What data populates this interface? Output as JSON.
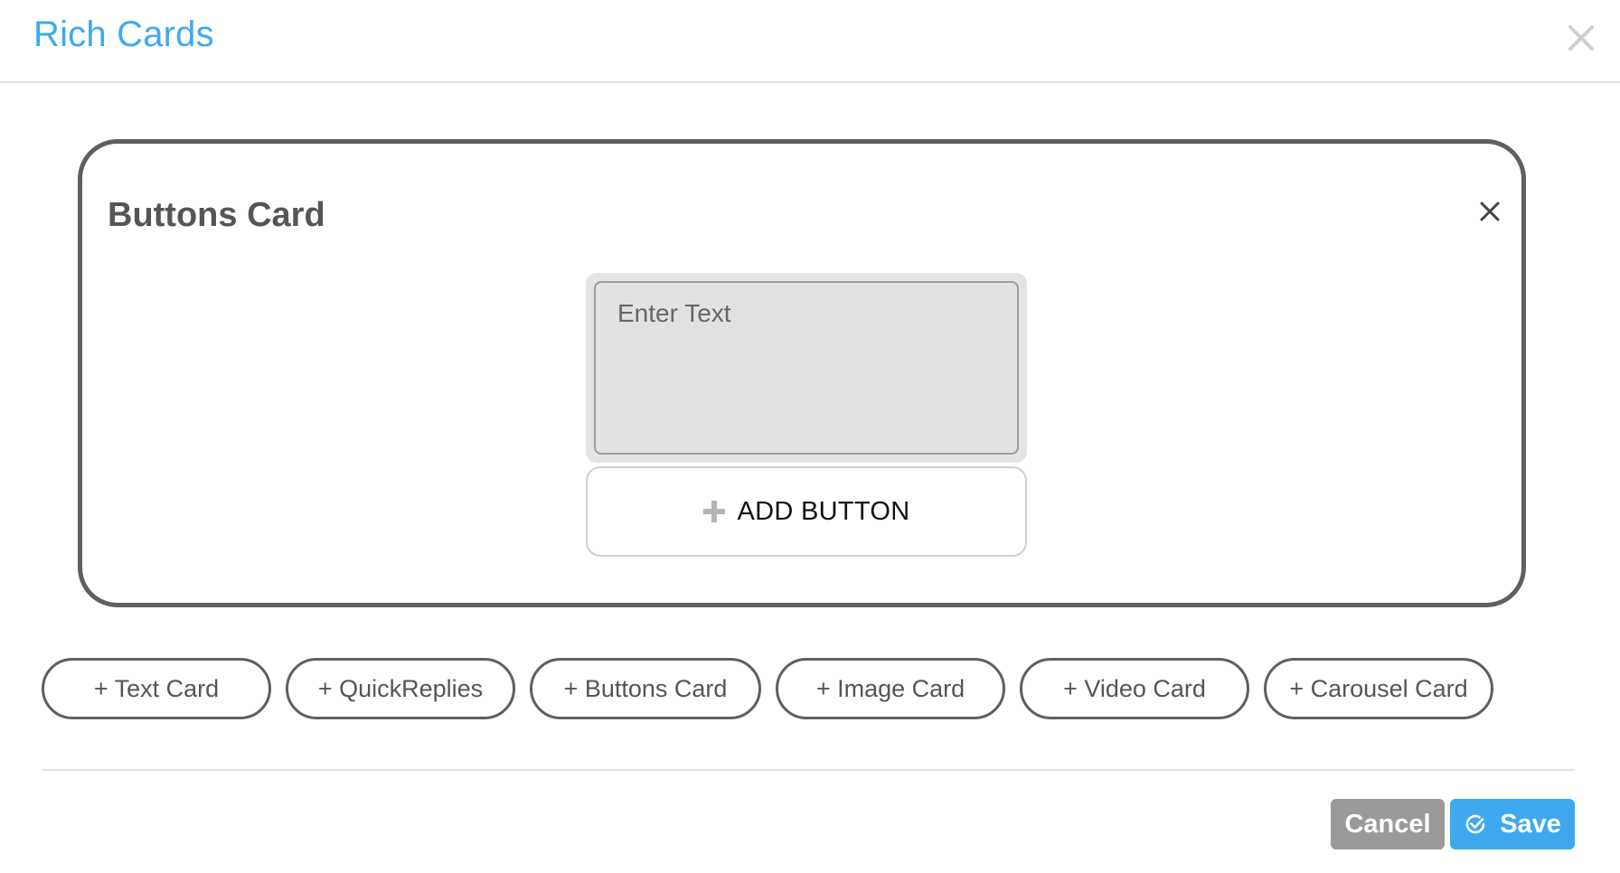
{
  "header": {
    "title": "Rich Cards",
    "close_icon": "close-icon"
  },
  "card": {
    "title": "Buttons Card",
    "close_icon": "close-icon",
    "text_placeholder": "Enter Text",
    "text_value": "",
    "add_button_label": "ADD BUTTON",
    "add_button_icon": "plus-icon"
  },
  "add_cards": [
    {
      "label": "+ Text Card"
    },
    {
      "label": "+ QuickReplies"
    },
    {
      "label": "+ Buttons Card"
    },
    {
      "label": "+ Image Card"
    },
    {
      "label": "+ Video Card"
    },
    {
      "label": "+ Carousel Card"
    }
  ],
  "footer": {
    "cancel_label": "Cancel",
    "save_label": "Save",
    "save_icon": "check-circle-icon"
  },
  "colors": {
    "accent": "#3fa9f0",
    "cancel": "#9a9a9a",
    "card_border": "#5f5f5f"
  }
}
